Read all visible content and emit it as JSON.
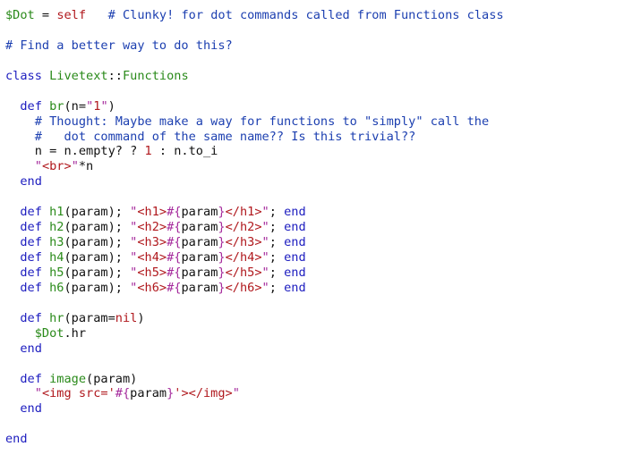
{
  "colors": {
    "plain": "#111111",
    "keyword": "#1c1cbf",
    "comment": "#1c3fb0",
    "string": "#b0181d",
    "constant": "#b0181d",
    "name": "#2a8a1a",
    "global": "#2a8a1a",
    "purple": "#a52a9c"
  },
  "lines": [
    [
      [
        "global",
        "$Dot"
      ],
      [
        "plain",
        " = "
      ],
      [
        "string",
        "self"
      ],
      [
        "plain",
        "   "
      ],
      [
        "comment",
        "# Clunky! for dot commands called from Functions class"
      ]
    ],
    [],
    [
      [
        "comment",
        "# Find a better way to do this?"
      ]
    ],
    [],
    [
      [
        "keyword",
        "class"
      ],
      [
        "plain",
        " "
      ],
      [
        "name",
        "Livetext"
      ],
      [
        "plain",
        "::"
      ],
      [
        "name",
        "Functions"
      ]
    ],
    [],
    [
      [
        "plain",
        "  "
      ],
      [
        "keyword",
        "def"
      ],
      [
        "plain",
        " "
      ],
      [
        "name",
        "br"
      ],
      [
        "plain",
        "(n="
      ],
      [
        "purple",
        "\""
      ],
      [
        "string",
        "1"
      ],
      [
        "purple",
        "\""
      ],
      [
        "plain",
        ")"
      ]
    ],
    [
      [
        "plain",
        "    "
      ],
      [
        "comment",
        "# Thought: Maybe make a way for functions to \"simply\" call the"
      ]
    ],
    [
      [
        "plain",
        "    "
      ],
      [
        "comment",
        "#   dot command of the same name?? Is this trivial??"
      ]
    ],
    [
      [
        "plain",
        "    n = n.empty? ? "
      ],
      [
        "string",
        "1"
      ],
      [
        "plain",
        " : n.to_i"
      ]
    ],
    [
      [
        "plain",
        "    "
      ],
      [
        "purple",
        "\""
      ],
      [
        "string",
        "<br>"
      ],
      [
        "purple",
        "\""
      ],
      [
        "plain",
        "*n"
      ]
    ],
    [
      [
        "plain",
        "  "
      ],
      [
        "keyword",
        "end"
      ]
    ],
    [],
    [
      [
        "plain",
        "  "
      ],
      [
        "keyword",
        "def"
      ],
      [
        "plain",
        " "
      ],
      [
        "name",
        "h1"
      ],
      [
        "plain",
        "(param); "
      ],
      [
        "purple",
        "\""
      ],
      [
        "string",
        "<h1>"
      ],
      [
        "purple",
        "#{"
      ],
      [
        "plain",
        "param"
      ],
      [
        "purple",
        "}"
      ],
      [
        "string",
        "</h1>"
      ],
      [
        "purple",
        "\""
      ],
      [
        "plain",
        "; "
      ],
      [
        "keyword",
        "end"
      ]
    ],
    [
      [
        "plain",
        "  "
      ],
      [
        "keyword",
        "def"
      ],
      [
        "plain",
        " "
      ],
      [
        "name",
        "h2"
      ],
      [
        "plain",
        "(param); "
      ],
      [
        "purple",
        "\""
      ],
      [
        "string",
        "<h2>"
      ],
      [
        "purple",
        "#{"
      ],
      [
        "plain",
        "param"
      ],
      [
        "purple",
        "}"
      ],
      [
        "string",
        "</h2>"
      ],
      [
        "purple",
        "\""
      ],
      [
        "plain",
        "; "
      ],
      [
        "keyword",
        "end"
      ]
    ],
    [
      [
        "plain",
        "  "
      ],
      [
        "keyword",
        "def"
      ],
      [
        "plain",
        " "
      ],
      [
        "name",
        "h3"
      ],
      [
        "plain",
        "(param); "
      ],
      [
        "purple",
        "\""
      ],
      [
        "string",
        "<h3>"
      ],
      [
        "purple",
        "#{"
      ],
      [
        "plain",
        "param"
      ],
      [
        "purple",
        "}"
      ],
      [
        "string",
        "</h3>"
      ],
      [
        "purple",
        "\""
      ],
      [
        "plain",
        "; "
      ],
      [
        "keyword",
        "end"
      ]
    ],
    [
      [
        "plain",
        "  "
      ],
      [
        "keyword",
        "def"
      ],
      [
        "plain",
        " "
      ],
      [
        "name",
        "h4"
      ],
      [
        "plain",
        "(param); "
      ],
      [
        "purple",
        "\""
      ],
      [
        "string",
        "<h4>"
      ],
      [
        "purple",
        "#{"
      ],
      [
        "plain",
        "param"
      ],
      [
        "purple",
        "}"
      ],
      [
        "string",
        "</h4>"
      ],
      [
        "purple",
        "\""
      ],
      [
        "plain",
        "; "
      ],
      [
        "keyword",
        "end"
      ]
    ],
    [
      [
        "plain",
        "  "
      ],
      [
        "keyword",
        "def"
      ],
      [
        "plain",
        " "
      ],
      [
        "name",
        "h5"
      ],
      [
        "plain",
        "(param); "
      ],
      [
        "purple",
        "\""
      ],
      [
        "string",
        "<h5>"
      ],
      [
        "purple",
        "#{"
      ],
      [
        "plain",
        "param"
      ],
      [
        "purple",
        "}"
      ],
      [
        "string",
        "</h5>"
      ],
      [
        "purple",
        "\""
      ],
      [
        "plain",
        "; "
      ],
      [
        "keyword",
        "end"
      ]
    ],
    [
      [
        "plain",
        "  "
      ],
      [
        "keyword",
        "def"
      ],
      [
        "plain",
        " "
      ],
      [
        "name",
        "h6"
      ],
      [
        "plain",
        "(param); "
      ],
      [
        "purple",
        "\""
      ],
      [
        "string",
        "<h6>"
      ],
      [
        "purple",
        "#{"
      ],
      [
        "plain",
        "param"
      ],
      [
        "purple",
        "}"
      ],
      [
        "string",
        "</h6>"
      ],
      [
        "purple",
        "\""
      ],
      [
        "plain",
        "; "
      ],
      [
        "keyword",
        "end"
      ]
    ],
    [],
    [
      [
        "plain",
        "  "
      ],
      [
        "keyword",
        "def"
      ],
      [
        "plain",
        " "
      ],
      [
        "name",
        "hr"
      ],
      [
        "plain",
        "(param="
      ],
      [
        "string",
        "nil"
      ],
      [
        "plain",
        ")"
      ]
    ],
    [
      [
        "plain",
        "    "
      ],
      [
        "global",
        "$Dot"
      ],
      [
        "plain",
        ".hr"
      ]
    ],
    [
      [
        "plain",
        "  "
      ],
      [
        "keyword",
        "end"
      ]
    ],
    [],
    [
      [
        "plain",
        "  "
      ],
      [
        "keyword",
        "def"
      ],
      [
        "plain",
        " "
      ],
      [
        "name",
        "image"
      ],
      [
        "plain",
        "(param)"
      ]
    ],
    [
      [
        "plain",
        "    "
      ],
      [
        "purple",
        "\""
      ],
      [
        "string",
        "<img src='"
      ],
      [
        "purple",
        "#{"
      ],
      [
        "plain",
        "param"
      ],
      [
        "purple",
        "}"
      ],
      [
        "string",
        "'></img>"
      ],
      [
        "purple",
        "\""
      ]
    ],
    [
      [
        "plain",
        "  "
      ],
      [
        "keyword",
        "end"
      ]
    ],
    [],
    [
      [
        "keyword",
        "end"
      ]
    ]
  ]
}
